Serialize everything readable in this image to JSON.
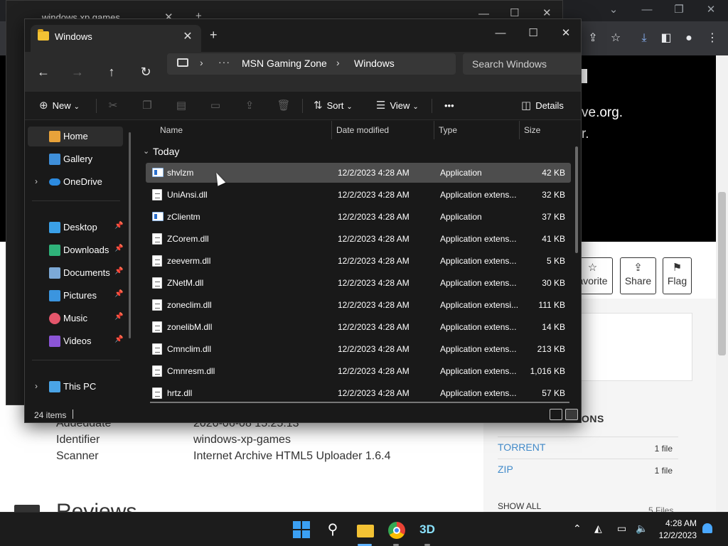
{
  "browser": {
    "tab_title": "windows xp games",
    "banner_line1": "ve.org.",
    "banner_line2": "r.",
    "actions": {
      "favorite_label": "avorite",
      "share_label": "Share",
      "flag_label": "Flag"
    },
    "metadata": [
      {
        "label": "Addeddate",
        "value": "2020-06-08 15:25:13"
      },
      {
        "label": "Identifier",
        "value": "windows-xp-games"
      },
      {
        "label": "Scanner",
        "value": "Internet Archive HTML5 Uploader 1.6.4"
      }
    ],
    "reviews_heading": "Reviews",
    "downloads_heading": "ONS",
    "downloads": [
      {
        "name": "TORRENT",
        "count": "1 file"
      },
      {
        "name": "ZIP",
        "count": "1 file"
      }
    ],
    "show_all": "SHOW ALL",
    "files_count": "5 Files"
  },
  "explorer": {
    "tab_title": "Windows",
    "breadcrumb": [
      "MSN Gaming Zone",
      "Windows"
    ],
    "search_placeholder": "Search Windows",
    "commands": {
      "new": "New",
      "sort": "Sort",
      "view": "View",
      "more": "•••",
      "details": "Details"
    },
    "nav": {
      "home": "Home",
      "gallery": "Gallery",
      "onedrive": "OneDrive",
      "desktop": "Desktop",
      "downloads": "Downloads",
      "documents": "Documents",
      "pictures": "Pictures",
      "music": "Music",
      "videos": "Videos",
      "this_pc": "This PC"
    },
    "columns": {
      "name": "Name",
      "date": "Date modified",
      "type": "Type",
      "size": "Size"
    },
    "group": "Today",
    "files": [
      {
        "name": "shvlzm",
        "date": "12/2/2023 4:28 AM",
        "type": "Application",
        "size": "42 KB",
        "kind": "app"
      },
      {
        "name": "UniAnsi.dll",
        "date": "12/2/2023 4:28 AM",
        "type": "Application extens...",
        "size": "32 KB",
        "kind": "dll"
      },
      {
        "name": "zClientm",
        "date": "12/2/2023 4:28 AM",
        "type": "Application",
        "size": "37 KB",
        "kind": "app"
      },
      {
        "name": "ZCorem.dll",
        "date": "12/2/2023 4:28 AM",
        "type": "Application extens...",
        "size": "41 KB",
        "kind": "dll"
      },
      {
        "name": "zeeverm.dll",
        "date": "12/2/2023 4:28 AM",
        "type": "Application extens...",
        "size": "5 KB",
        "kind": "dll"
      },
      {
        "name": "ZNetM.dll",
        "date": "12/2/2023 4:28 AM",
        "type": "Application extens...",
        "size": "30 KB",
        "kind": "dll"
      },
      {
        "name": "zoneclim.dll",
        "date": "12/2/2023 4:28 AM",
        "type": "Application extensi...",
        "size": "111 KB",
        "kind": "dll"
      },
      {
        "name": "zonelibM.dll",
        "date": "12/2/2023 4:28 AM",
        "type": "Application extens...",
        "size": "14 KB",
        "kind": "dll"
      },
      {
        "name": "Cmnclim.dll",
        "date": "12/2/2023 4:28 AM",
        "type": "Application extens...",
        "size": "213 KB",
        "kind": "dll"
      },
      {
        "name": "Cmnresm.dll",
        "date": "12/2/2023 4:28 AM",
        "type": "Application extens...",
        "size": "1,016 KB",
        "kind": "dll"
      },
      {
        "name": "hrtz.dll",
        "date": "12/2/2023 4:28 AM",
        "type": "Application extens...",
        "size": "57 KB",
        "kind": "dll"
      }
    ],
    "status": "24 items"
  },
  "taskbar": {
    "time": "4:28 AM",
    "date": "12/2/2023",
    "xp_label": "3D"
  },
  "icons": {
    "back": "back-arrow-icon",
    "forward": "forward-arrow-icon",
    "up": "up-arrow-icon",
    "refresh": "refresh-icon",
    "cut": "cut-icon",
    "copy": "copy-icon",
    "paste": "paste-icon",
    "rename": "rename-icon",
    "share": "share-icon",
    "delete": "delete-icon"
  },
  "colors": {
    "accent": "#3ba0f3",
    "folder": "#f3c234",
    "link": "#428bca"
  }
}
